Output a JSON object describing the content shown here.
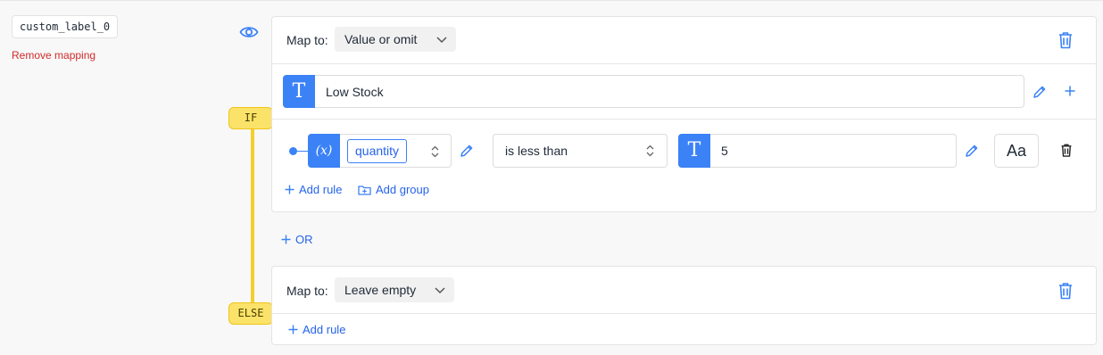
{
  "field": {
    "name": "custom_label_0",
    "remove_label": "Remove mapping"
  },
  "branches": {
    "if_label": "IF",
    "else_label": "ELSE"
  },
  "if_block": {
    "map_to_label": "Map to:",
    "map_to_value": "Value or omit",
    "value": {
      "type_icon": "T",
      "text": "Low Stock"
    },
    "condition": {
      "variable_icon": "(x)",
      "variable": "quantity",
      "operator": "is less than",
      "value_type_icon": "T",
      "value": "5",
      "case_toggle": "Aa"
    },
    "add_rule_label": "Add rule",
    "add_group_label": "Add group"
  },
  "or_label": "OR",
  "else_block": {
    "map_to_label": "Map to:",
    "map_to_value": "Leave empty",
    "add_rule_label": "Add rule"
  },
  "colors": {
    "accent": "#3b82f6",
    "danger": "#d12b2b",
    "branch_yellow": "#f5cf2b"
  }
}
